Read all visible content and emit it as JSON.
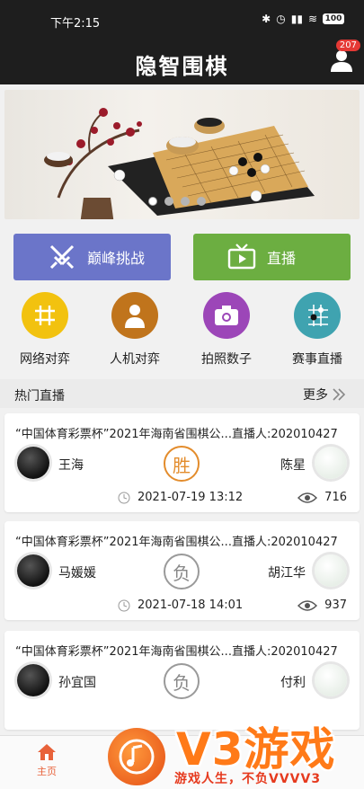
{
  "status_bar": {
    "time": "下午2:15",
    "battery": "100"
  },
  "app_bar": {
    "title": "隐智围棋",
    "notification_count": "207"
  },
  "banner": {
    "page_dots": 4,
    "active_dot": 1
  },
  "actions": {
    "challenge_label": "巅峰挑战",
    "live_label": "直播"
  },
  "features": [
    {
      "label": "网络对弈",
      "color": "#f2c20f",
      "icon": "grid-icon"
    },
    {
      "label": "人机对弈",
      "color": "#c0741c",
      "icon": "person-icon"
    },
    {
      "label": "拍照数子",
      "color": "#9c46b8",
      "icon": "camera-icon"
    },
    {
      "label": "赛事直播",
      "color": "#3fa3b0",
      "icon": "board-icon"
    }
  ],
  "section": {
    "title": "热门直播",
    "more_label": "更多"
  },
  "games": [
    {
      "title": "“中国体育彩票杯”2021年海南省围棋公...直播人:202010427",
      "black_player": "王海",
      "white_player": "陈星",
      "result": "胜",
      "date": "2021-07-19 13:12",
      "views": "716"
    },
    {
      "title": "“中国体育彩票杯”2021年海南省围棋公...直播人:202010427",
      "black_player": "马媛媛",
      "white_player": "胡江华",
      "result": "负",
      "date": "2021-07-18 14:01",
      "views": "937"
    },
    {
      "title": "“中国体育彩票杯”2021年海南省围棋公...直播人:202010427",
      "black_player": "孙宜国",
      "white_player": "付利",
      "result": "负",
      "date": "",
      "views": ""
    }
  ],
  "tab_bar": {
    "home_label": "主页"
  },
  "watermark": {
    "brand": "V3游戏",
    "slogan": "游戏人生，不负VVVV3"
  }
}
